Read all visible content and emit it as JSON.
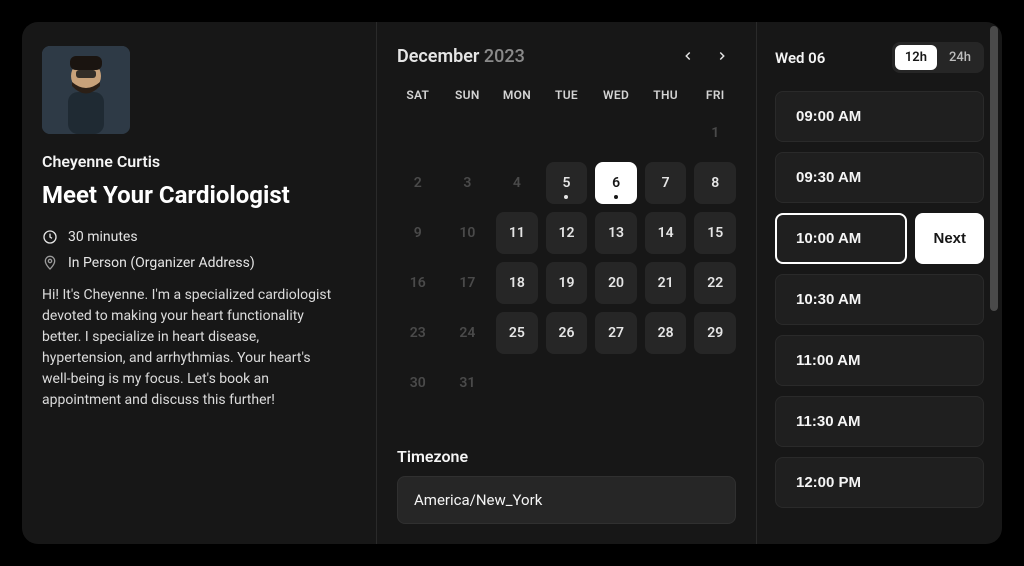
{
  "host": {
    "name": "Cheyenne Curtis",
    "event_title": "Meet Your Cardiologist",
    "duration": "30 minutes",
    "location": "In Person (Organizer Address)",
    "description": "Hi! It's Cheyenne. I'm a specialized cardiologist devoted to making your heart functionality better. I specialize in heart disease, hypertension, and arrhythmias. Your heart's well-being is my focus. Let's book an appointment and discuss this further!"
  },
  "calendar": {
    "month": "December",
    "year": "2023",
    "dow": [
      "SAT",
      "SUN",
      "MON",
      "TUE",
      "WED",
      "THU",
      "FRI"
    ],
    "weeks": [
      [
        {
          "n": "",
          "dim": true
        },
        {
          "n": "",
          "dim": true
        },
        {
          "n": "",
          "dim": true
        },
        {
          "n": "",
          "dim": true
        },
        {
          "n": "",
          "dim": true
        },
        {
          "n": "",
          "dim": true
        },
        {
          "n": "1",
          "dim": true
        }
      ],
      [
        {
          "n": "2",
          "dim": true
        },
        {
          "n": "3",
          "dim": true
        },
        {
          "n": "4",
          "dim": true
        },
        {
          "n": "5",
          "avail": true,
          "dot": true
        },
        {
          "n": "6",
          "avail": true,
          "sel": true,
          "dot": true
        },
        {
          "n": "7",
          "avail": true
        },
        {
          "n": "8",
          "avail": true
        }
      ],
      [
        {
          "n": "9",
          "dim": true
        },
        {
          "n": "10",
          "dim": true
        },
        {
          "n": "11",
          "avail": true
        },
        {
          "n": "12",
          "avail": true
        },
        {
          "n": "13",
          "avail": true
        },
        {
          "n": "14",
          "avail": true
        },
        {
          "n": "15",
          "avail": true
        }
      ],
      [
        {
          "n": "16",
          "dim": true
        },
        {
          "n": "17",
          "dim": true
        },
        {
          "n": "18",
          "avail": true
        },
        {
          "n": "19",
          "avail": true
        },
        {
          "n": "20",
          "avail": true
        },
        {
          "n": "21",
          "avail": true
        },
        {
          "n": "22",
          "avail": true
        }
      ],
      [
        {
          "n": "23",
          "dim": true
        },
        {
          "n": "24",
          "dim": true
        },
        {
          "n": "25",
          "avail": true
        },
        {
          "n": "26",
          "avail": true
        },
        {
          "n": "27",
          "avail": true
        },
        {
          "n": "28",
          "avail": true
        },
        {
          "n": "29",
          "avail": true
        }
      ],
      [
        {
          "n": "30",
          "dim": true
        },
        {
          "n": "31",
          "dim": true
        },
        {
          "n": "",
          "dim": true
        },
        {
          "n": "",
          "dim": true
        },
        {
          "n": "",
          "dim": true
        },
        {
          "n": "",
          "dim": true
        },
        {
          "n": "",
          "dim": true
        }
      ]
    ],
    "timezone_label": "Timezone",
    "timezone_value": "America/New_York"
  },
  "slots": {
    "selected_date": "Wed 06",
    "format_12h": "12h",
    "format_24h": "24h",
    "format_active": "12h",
    "next_label": "Next",
    "selected_index": 2,
    "times": [
      "09:00 AM",
      "09:30 AM",
      "10:00 AM",
      "10:30 AM",
      "11:00 AM",
      "11:30 AM",
      "12:00 PM"
    ]
  }
}
